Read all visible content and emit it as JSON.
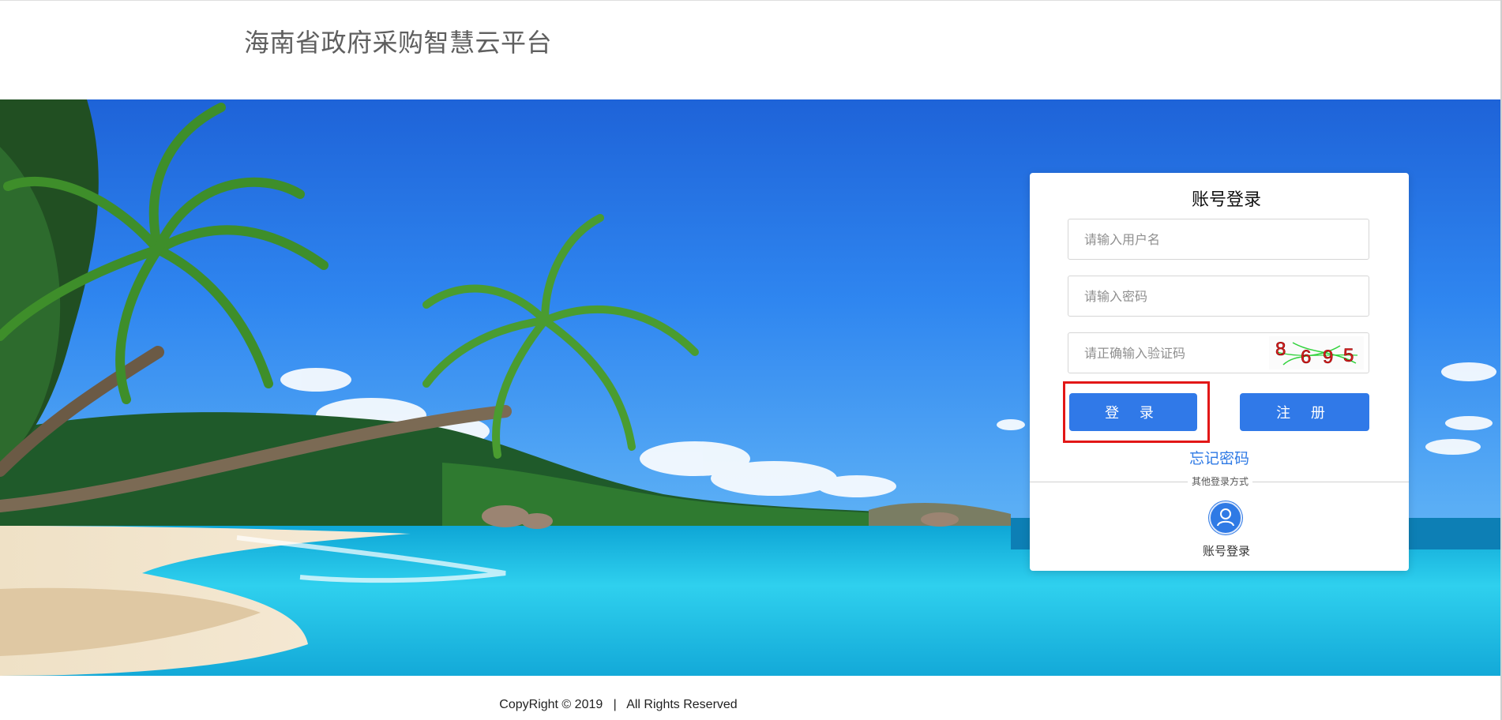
{
  "header": {
    "title": "海南省政府采购智慧云平台"
  },
  "login": {
    "title": "账号登录",
    "username_placeholder": "请输入用户名",
    "password_placeholder": "请输入密码",
    "captcha_placeholder": "请正确输入验证码",
    "captcha_digits": [
      "8",
      "6",
      "9",
      "5"
    ],
    "login_button": "登 录",
    "register_button": "注 册",
    "forgot_link": "忘记密码",
    "other_methods_label": "其他登录方式",
    "account_login_label": "账号登录"
  },
  "footer": {
    "copyright": "CopyRight © 2019   |   All Rights Reserved"
  },
  "colors": {
    "accent": "#3079e8",
    "link": "#2f7ae5",
    "highlight": "#e21717",
    "captcha_text": "#e02020",
    "captcha_noise": "#2fd23a"
  },
  "icons": {
    "account_login": "user-icon"
  }
}
